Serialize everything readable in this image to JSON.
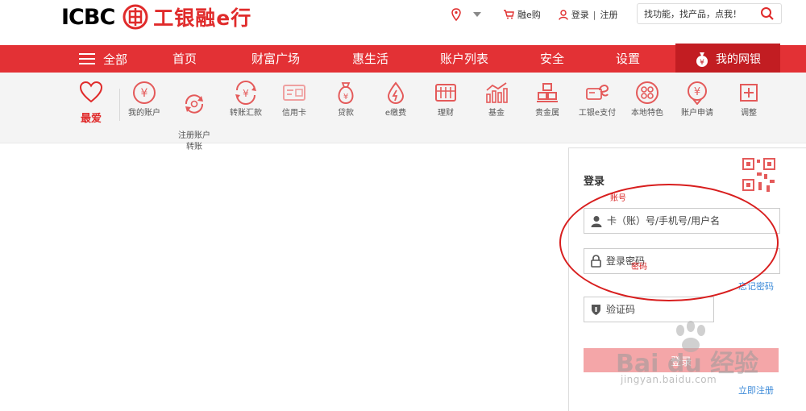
{
  "header": {
    "logo_text": "ICBC",
    "logo_cn": "工银融e行",
    "links": {
      "shop": "融e购",
      "login": "登录",
      "separator": "|",
      "register": "注册"
    },
    "search": {
      "placeholder": "找功能，找产品，点我！"
    }
  },
  "nav": {
    "all": "全部",
    "items": [
      "首页",
      "财富广场",
      "惠生活",
      "账户列表",
      "安全",
      "设置"
    ],
    "mybank": "我的网银"
  },
  "iconbar": {
    "favorite": "最爱",
    "items": [
      {
        "label": "我的账户",
        "icon": "yen-circle-icon"
      },
      {
        "label": "注册账户\n转账",
        "icon": "transfer-icon"
      },
      {
        "label": "转账汇款",
        "icon": "remit-icon"
      },
      {
        "label": "信用卡",
        "icon": "credit-card-icon"
      },
      {
        "label": "贷款",
        "icon": "money-bag-icon"
      },
      {
        "label": "e缴费",
        "icon": "drop-icon"
      },
      {
        "label": "理财",
        "icon": "abacus-icon"
      },
      {
        "label": "基金",
        "icon": "chart-icon"
      },
      {
        "label": "贵金属",
        "icon": "gold-bars-icon"
      },
      {
        "label": "工银e支付",
        "icon": "epay-icon"
      },
      {
        "label": "本地特色",
        "icon": "local-icon"
      },
      {
        "label": "账户申请",
        "icon": "apply-icon"
      },
      {
        "label": "调整",
        "icon": "plus-box-icon"
      }
    ]
  },
  "login": {
    "title": "登录",
    "account_placeholder": "卡（账）号/手机号/用户名",
    "password_placeholder": "登录密码",
    "forgot": "忘记密码",
    "captcha_placeholder": "验证码",
    "button": "登录",
    "register": "立即注册"
  },
  "annotations": {
    "account": "账号",
    "password": "密码"
  },
  "watermark": {
    "main": "Bai du 经验",
    "sub": "jingyan.baidu.com"
  },
  "colors": {
    "brand_red": "#e33135",
    "link_blue": "#3d8bd9"
  }
}
